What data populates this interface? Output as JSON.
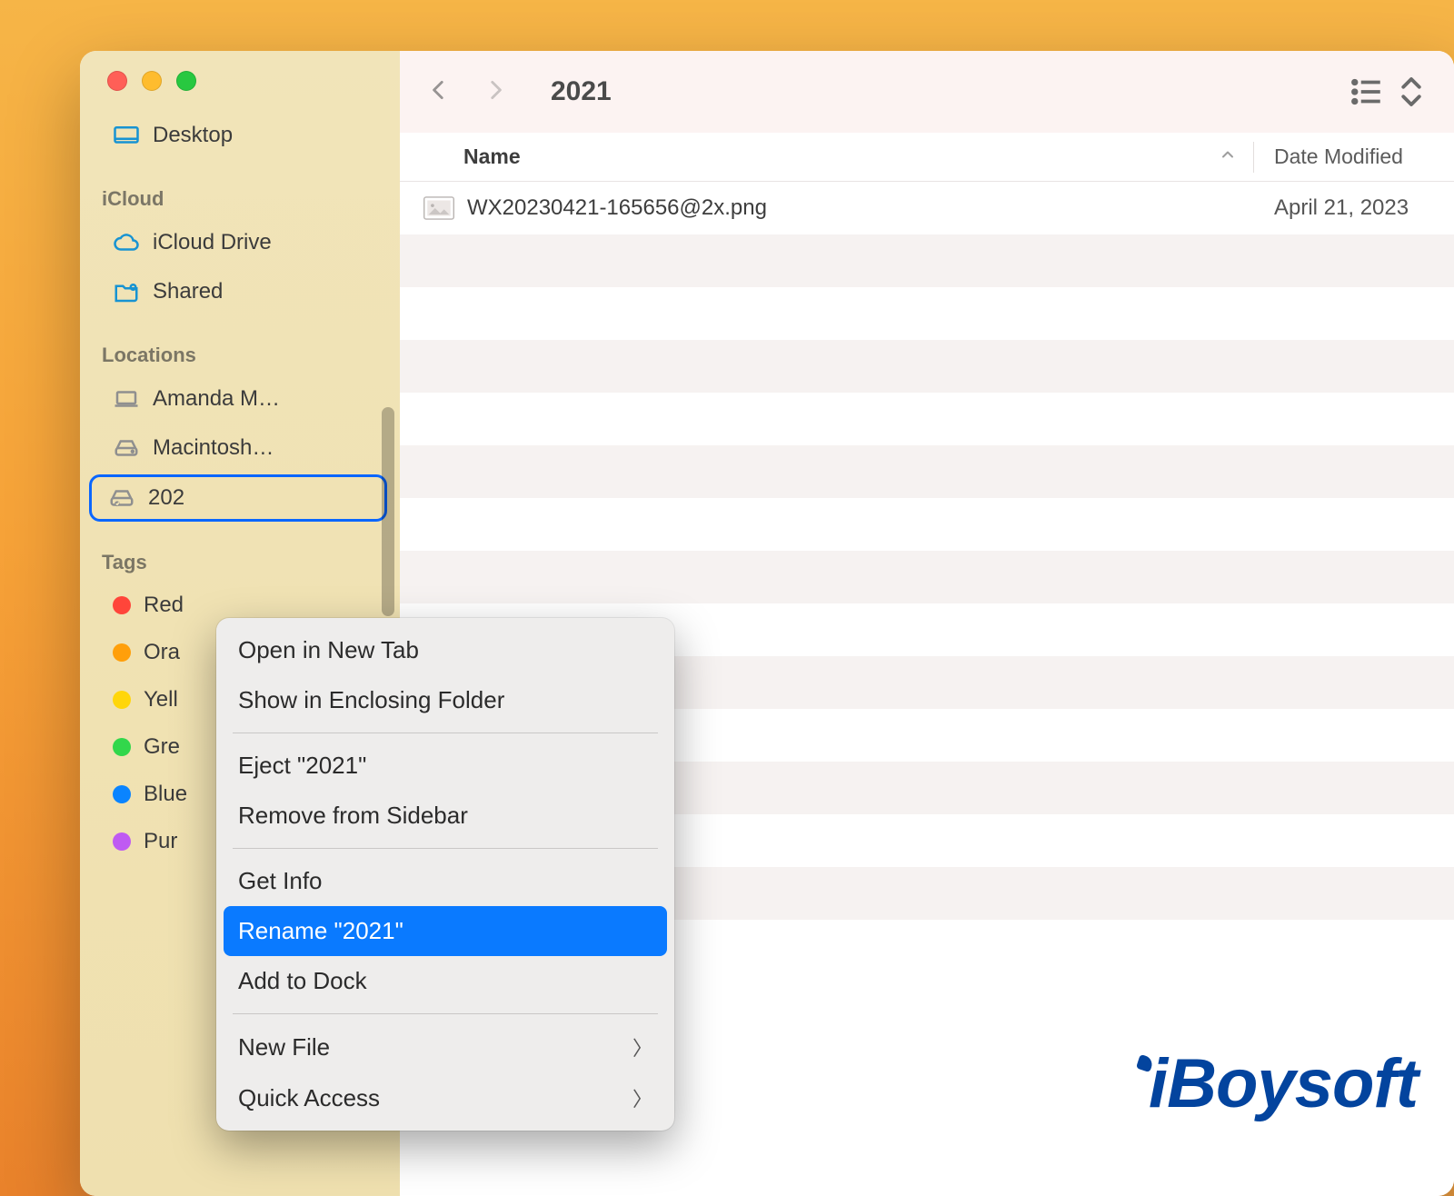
{
  "toolbar": {
    "title": "2021"
  },
  "header": {
    "name_label": "Name",
    "date_label": "Date Modified"
  },
  "file": {
    "name": "WX20230421-165656@2x.png",
    "date": "April 21, 2023"
  },
  "sidebar": {
    "favorites_item": "Desktop",
    "section_icloud": "iCloud",
    "icloud_drive": "iCloud Drive",
    "shared": "Shared",
    "section_locations": "Locations",
    "loc_item1": "Amanda M…",
    "loc_item2": "Macintosh…",
    "loc_item3": "202",
    "section_tags": "Tags",
    "tags": [
      {
        "label": "Red",
        "color": "#ff453a"
      },
      {
        "label": "Ora",
        "color": "#ff9f0a"
      },
      {
        "label": "Yell",
        "color": "#ffd60a"
      },
      {
        "label": "Gre",
        "color": "#32d74b"
      },
      {
        "label": "Blue",
        "color": "#0a84ff"
      },
      {
        "label": "Pur",
        "color": "#bf5af2"
      }
    ]
  },
  "context_menu": {
    "open_new_tab": "Open in New Tab",
    "show_enclosing": "Show in Enclosing Folder",
    "eject": "Eject \"2021\"",
    "remove_sidebar": "Remove from Sidebar",
    "get_info": "Get Info",
    "rename": "Rename \"2021\"",
    "add_to_dock": "Add to Dock",
    "new_file": "New File",
    "quick_access": "Quick Access"
  },
  "watermark": "iBoysoft"
}
